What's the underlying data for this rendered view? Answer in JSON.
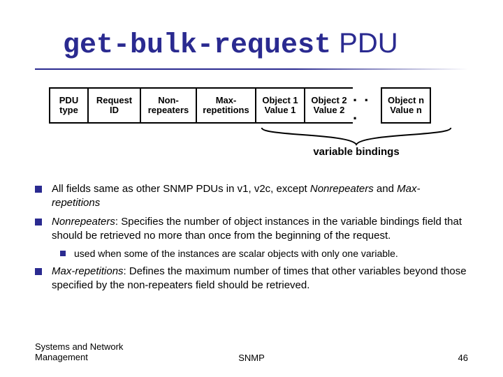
{
  "title_code": "get-bulk-request",
  "title_suffix": " PDU",
  "diagram": {
    "cells": [
      {
        "l1": "PDU",
        "l2": "type"
      },
      {
        "l1": "Request",
        "l2": "ID"
      },
      {
        "l1": "Non-",
        "l2": "repeaters"
      },
      {
        "l1": "Max-",
        "l2": "repetitions"
      },
      {
        "l1": "Object 1",
        "l2": "Value 1"
      },
      {
        "l1": "Object 2",
        "l2": "Value 2"
      },
      {
        "l1": "Object n",
        "l2": "Value n"
      }
    ],
    "ellipsis": ". . .",
    "brace_label": "variable bindings"
  },
  "bullets": {
    "b1_a": "All fields same as other SNMP PDUs in v1, v2c, except ",
    "b1_nr": "Nonrepeaters",
    "b1_and": " and ",
    "b1_mr": "Max-repetitions",
    "b2_nr": "Nonrepeaters",
    "b2_rest": ": Specifies the number of object instances in the variable bindings field that should be retrieved no more than once from the beginning of the request.",
    "b2_sub": "used when some of the instances are scalar objects with only one variable.",
    "b3_mr": "Max-repetitions",
    "b3_rest": ": Defines the maximum number of times that other variables beyond those specified by the non-repeaters field should be retrieved."
  },
  "footer": {
    "left_l1": "Systems and Network",
    "left_l2": "Management",
    "center": "SNMP",
    "pagenum": "46"
  }
}
